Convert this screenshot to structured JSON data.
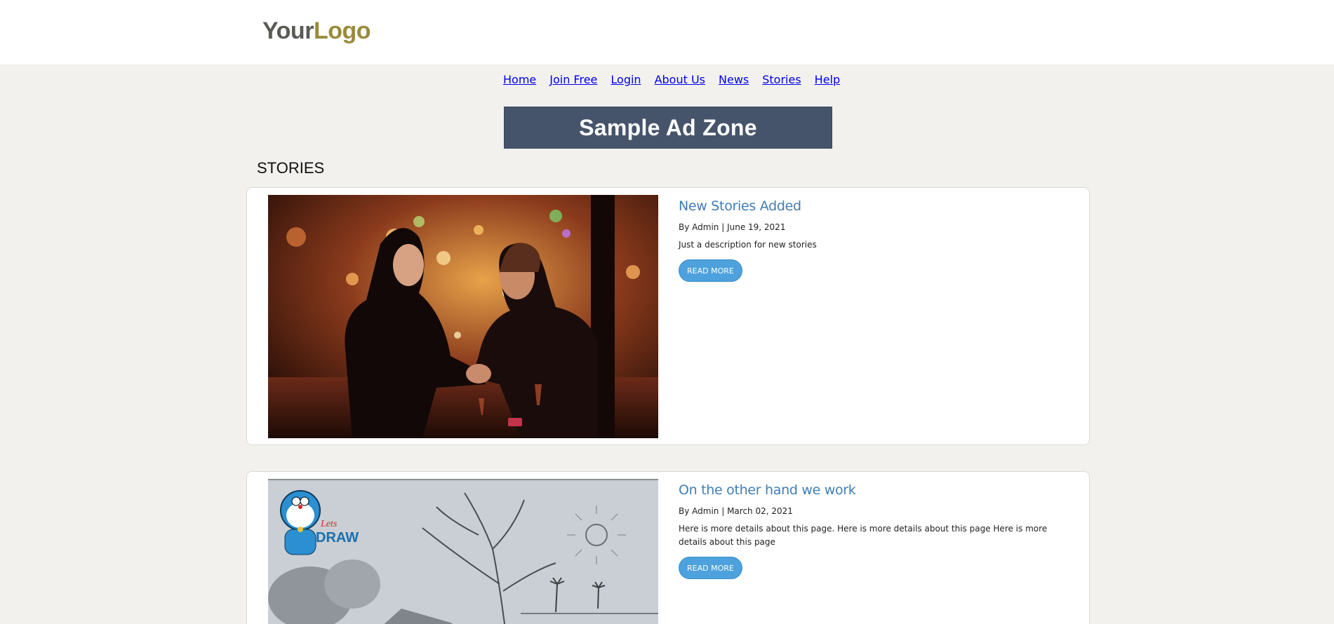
{
  "logo": {
    "part1": "Your",
    "part2": "Logo"
  },
  "nav": [
    "Home",
    "Join Free",
    "Login",
    "About Us",
    "News",
    "Stories",
    "Help"
  ],
  "ad": {
    "label": "Sample Ad Zone"
  },
  "section": {
    "title": "STORIES"
  },
  "stories": [
    {
      "title": "New Stories Added",
      "meta": "By Admin | June 19, 2021",
      "description": "Just a description for new stories",
      "button": "READ MORE",
      "image": "couple-dinner-photo"
    },
    {
      "title": "On the other hand we work",
      "meta": "By Admin | March 02, 2021",
      "description": "Here is more details about this page. Here is more details about this page Here is more details about this page",
      "button": "READ MORE",
      "image": "lets-draw-sketch-photo",
      "image_text": "Lets DRAW"
    }
  ],
  "colors": {
    "accent": "#3f7db6",
    "button": "#4da1dc",
    "ad_bg": "#46546b",
    "logo_gold": "#9a8b3a"
  }
}
